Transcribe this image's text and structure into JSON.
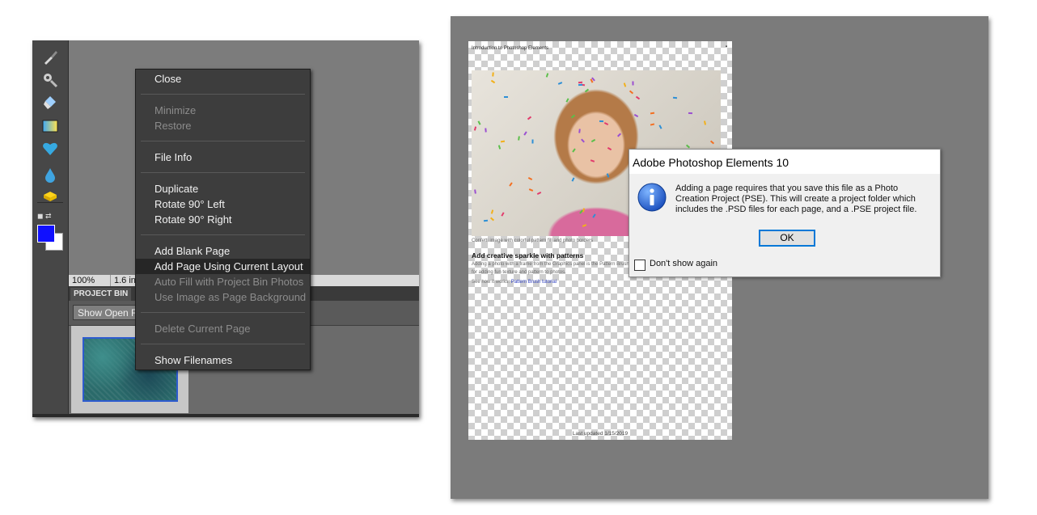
{
  "left_window": {
    "status_bar": {
      "zoom": "100%",
      "doc_size": "1.6 inc"
    },
    "project_bin": {
      "tab_label": "PROJECT BIN",
      "show_open_label": "Show Open F"
    },
    "context_menu": {
      "groups": [
        [
          {
            "label": "Close",
            "enabled": true
          }
        ],
        [
          {
            "label": "Minimize",
            "enabled": false
          },
          {
            "label": "Restore",
            "enabled": false
          }
        ],
        [
          {
            "label": "File Info",
            "enabled": true
          }
        ],
        [
          {
            "label": "Duplicate",
            "enabled": true
          },
          {
            "label": "Rotate 90° Left",
            "enabled": true
          },
          {
            "label": "Rotate 90° Right",
            "enabled": true
          }
        ],
        [
          {
            "label": "Add Blank Page",
            "enabled": true
          },
          {
            "label": "Add Page Using Current Layout",
            "enabled": true,
            "highlighted": true
          },
          {
            "label": "Auto Fill with Project Bin Photos",
            "enabled": false
          },
          {
            "label": "Use Image as Page Background",
            "enabled": false
          }
        ],
        [
          {
            "label": "Delete Current Page",
            "enabled": false
          }
        ],
        [
          {
            "label": "Show Filenames",
            "enabled": true
          }
        ]
      ]
    },
    "tools": [
      "brush-icon",
      "gear-tool-icon",
      "paint-bucket-icon",
      "gradient-icon",
      "heart-shape-icon",
      "blur-drop-icon",
      "sponge-icon"
    ],
    "colors": {
      "foreground": "#1010ff",
      "background": "#ffffff"
    }
  },
  "right_window": {
    "document": {
      "header": "Introduction to Photoshop Elements",
      "caption": "Confetti image with colorful pattern fill and photo borders",
      "heading": "Add creative sparkle with patterns",
      "body_1": "Adding a photo with a frame from the Graphics panel is the Pattern Brush",
      "body_2": "for adding fun texture and pattern to photos.",
      "link_prefix": "See how it works: ",
      "link_text": "Pattern Brush tutorial",
      "footer": "Last updated 1/15/2019"
    },
    "dialog": {
      "title": "Adobe Photoshop Elements 10",
      "message_lines": [
        "Adding a page requires that you save this file as a Photo",
        "Creation Project (PSE). This will create a project folder which",
        "includes the .PSD files for each page, and a .PSE project file."
      ],
      "ok_label": "OK",
      "checkbox_label": "Don't show again",
      "checkbox_checked": false
    }
  }
}
